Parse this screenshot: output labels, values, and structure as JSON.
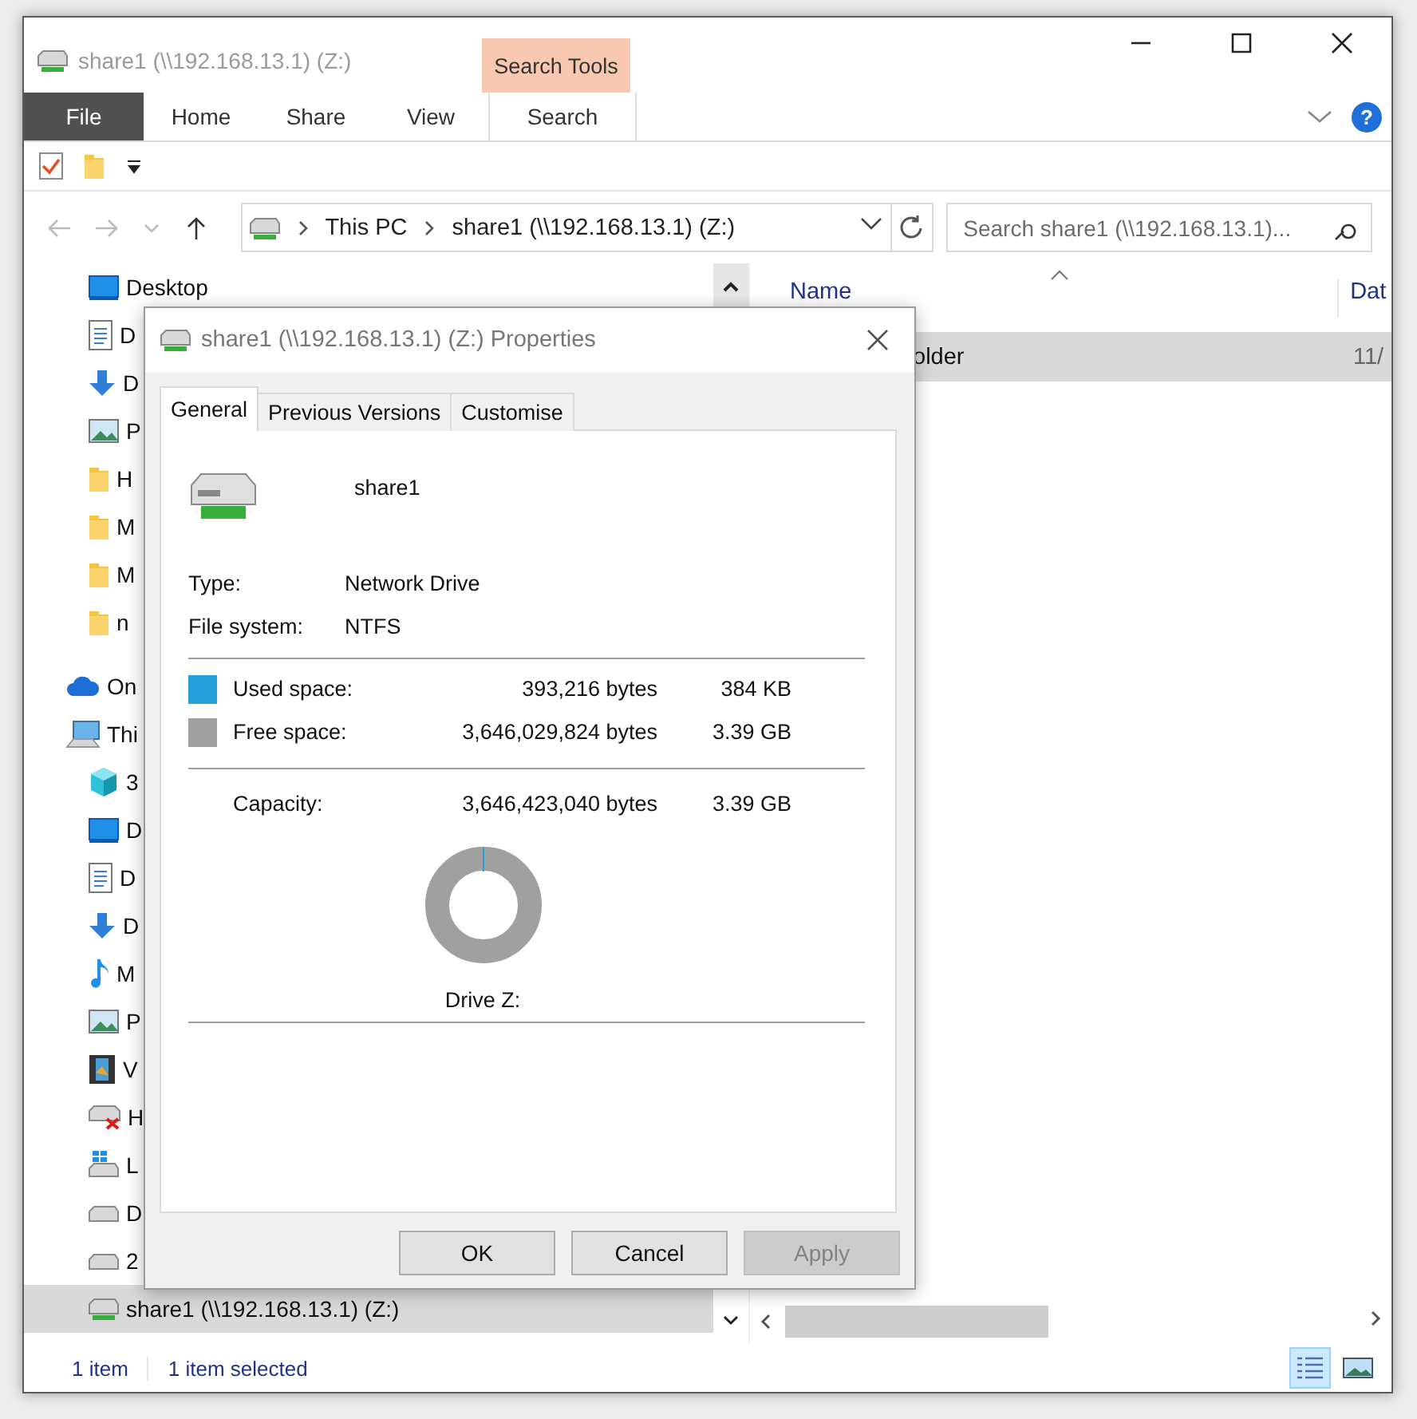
{
  "window": {
    "title": "share1 (\\\\192.168.13.1) (Z:)",
    "context_group": "Search Tools",
    "help": "?"
  },
  "ribbon": {
    "tabs": [
      {
        "label": "File",
        "kind": "file"
      },
      {
        "label": "Home",
        "kind": "tab"
      },
      {
        "label": "Share",
        "kind": "tab"
      },
      {
        "label": "View",
        "kind": "tab"
      },
      {
        "label": "Search",
        "kind": "contextual"
      }
    ]
  },
  "address": {
    "crumbs": [
      "This PC",
      "share1 (\\\\192.168.13.1) (Z:)"
    ]
  },
  "search": {
    "placeholder": "Search share1 (\\\\192.168.13.1)..."
  },
  "sidebar": {
    "quick_access": [
      {
        "label": "Desktop",
        "kind": "monitor",
        "selected": false
      },
      {
        "label": "D",
        "kind": "document",
        "selected": false
      },
      {
        "label": "D",
        "kind": "download",
        "selected": false
      },
      {
        "label": "P",
        "kind": "picture",
        "selected": false
      },
      {
        "label": "H",
        "kind": "folder",
        "selected": false
      },
      {
        "label": "M",
        "kind": "folder",
        "selected": false
      },
      {
        "label": "M",
        "kind": "folder",
        "selected": false
      },
      {
        "label": "n",
        "kind": "folder",
        "selected": false
      }
    ],
    "tree": [
      {
        "label": "On",
        "kind": "cloud",
        "selected": false
      },
      {
        "label": "Thi",
        "kind": "pc",
        "selected": false,
        "children": [
          {
            "label": "3",
            "kind": "cube",
            "selected": false
          },
          {
            "label": "D",
            "kind": "monitor",
            "selected": false
          },
          {
            "label": "D",
            "kind": "document",
            "selected": false
          },
          {
            "label": "D",
            "kind": "download",
            "selected": false
          },
          {
            "label": "M",
            "kind": "music",
            "selected": false
          },
          {
            "label": "P",
            "kind": "picture",
            "selected": false
          },
          {
            "label": "V",
            "kind": "video",
            "selected": false
          },
          {
            "label": "H",
            "kind": "drive-x",
            "selected": false
          },
          {
            "label": "L",
            "kind": "drive-win",
            "selected": false
          },
          {
            "label": "D",
            "kind": "drive",
            "selected": false
          },
          {
            "label": "2",
            "kind": "drive",
            "selected": false
          },
          {
            "label": "share1 (\\\\192.168.13.1) (Z:)",
            "kind": "netdrive",
            "selected": true
          }
        ]
      }
    ]
  },
  "content": {
    "columns": [
      "Name",
      "Dat"
    ],
    "rows": [
      {
        "name": "older",
        "date": "11/",
        "selected": true
      }
    ]
  },
  "status_bar": {
    "items": [
      "1 item",
      "1 item selected"
    ],
    "view_buttons": [
      {
        "kind": "details",
        "selected": true
      },
      {
        "kind": "tiles",
        "selected": false
      }
    ]
  },
  "dialog": {
    "title": "share1 (\\\\192.168.13.1) (Z:) Properties",
    "tabs": [
      {
        "label": "General",
        "selected": true
      },
      {
        "label": "Previous Versions",
        "selected": false
      },
      {
        "label": "Customise",
        "selected": false
      }
    ],
    "name": "share1",
    "properties": [
      {
        "label": "Type:",
        "value": "Network Drive"
      },
      {
        "label": "File system:",
        "value": "NTFS"
      }
    ],
    "space": [
      {
        "label": "Used space:",
        "bytes": "393,216 bytes",
        "size": "384 KB",
        "color": "#26a0da"
      },
      {
        "label": "Free space:",
        "bytes": "3,646,029,824 bytes",
        "size": "3.39 GB",
        "color": "#a0a0a0"
      }
    ],
    "capacity": {
      "label": "Capacity:",
      "bytes": "3,646,423,040 bytes",
      "size": "3.39 GB"
    },
    "drive_label": "Drive Z:",
    "buttons": [
      {
        "label": "OK",
        "disabled": false
      },
      {
        "label": "Cancel",
        "disabled": false
      },
      {
        "label": "Apply",
        "disabled": true
      }
    ]
  }
}
